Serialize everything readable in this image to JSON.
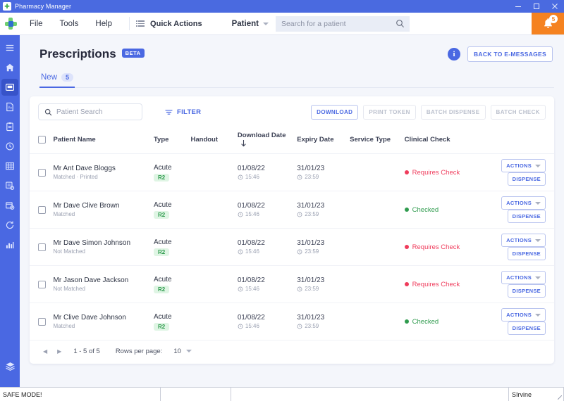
{
  "window": {
    "title": "Pharmacy Manager",
    "app_icon": "pharmacy-cross-icon",
    "minimize": "—",
    "maximize": "□",
    "close": "✕"
  },
  "menubar": {
    "items": [
      "File",
      "Tools",
      "Help"
    ],
    "quick_actions_label": "Quick Actions",
    "patient_dropdown_label": "Patient",
    "patient_search_placeholder": "Search for a patient",
    "notification_count": "5"
  },
  "sidebar": {
    "items": [
      {
        "icon": "hamburger-menu-icon",
        "active": false
      },
      {
        "icon": "home-icon",
        "active": false
      },
      {
        "icon": "messages-icon",
        "active": true
      },
      {
        "icon": "prescription-document-icon",
        "active": false
      },
      {
        "icon": "clipboard-icon",
        "active": false
      },
      {
        "icon": "clock-icon",
        "active": false
      },
      {
        "icon": "grid-icon",
        "active": false
      },
      {
        "icon": "report-icon",
        "active": false
      },
      {
        "icon": "calendar-clock-icon",
        "active": false
      },
      {
        "icon": "refresh-circle-icon",
        "active": false
      },
      {
        "icon": "bar-chart-icon",
        "active": false
      }
    ],
    "bottom_icon": "layers-icon"
  },
  "header": {
    "title": "Prescriptions",
    "badge": "BETA",
    "info_icon": "i",
    "back_button": "BACK TO E-MESSAGES"
  },
  "tabs": [
    {
      "label": "New",
      "count": "5",
      "active": true
    }
  ],
  "toolbar": {
    "search_placeholder": "Patient Search",
    "search_value": "",
    "filter_label": "FILTER",
    "buttons": [
      {
        "label": "DOWNLOAD",
        "disabled": false
      },
      {
        "label": "PRINT TOKEN",
        "disabled": true
      },
      {
        "label": "BATCH DISPENSE",
        "disabled": true
      },
      {
        "label": "BATCH CHECK",
        "disabled": true
      }
    ]
  },
  "table": {
    "columns": [
      "Patient Name",
      "Type",
      "Handout",
      "Download Date",
      "Expiry Date",
      "Service Type",
      "Clinical Check"
    ],
    "sorted_column": "Download Date",
    "sort_direction": "desc",
    "row_actions": {
      "actions": "ACTIONS",
      "dispense": "DISPENSE"
    },
    "rows": [
      {
        "name": "Mr Ant Dave Bloggs",
        "status": "Matched · Printed",
        "type": "Acute",
        "rx_badge": "R2",
        "handout": "",
        "download_date": "01/08/22",
        "download_time": "15:46",
        "expiry_date": "31/01/23",
        "expiry_time": "23:59",
        "service_type": "",
        "clinical_check": "Requires Check",
        "clinical_state": "requires"
      },
      {
        "name": "Mr Dave Clive Brown",
        "status": "Matched",
        "type": "Acute",
        "rx_badge": "R2",
        "handout": "",
        "download_date": "01/08/22",
        "download_time": "15:46",
        "expiry_date": "31/01/23",
        "expiry_time": "23:59",
        "service_type": "",
        "clinical_check": "Checked",
        "clinical_state": "checked"
      },
      {
        "name": "Mr Dave Simon Johnson",
        "status": "Not Matched",
        "type": "Acute",
        "rx_badge": "R2",
        "handout": "",
        "download_date": "01/08/22",
        "download_time": "15:46",
        "expiry_date": "31/01/23",
        "expiry_time": "23:59",
        "service_type": "",
        "clinical_check": "Requires Check",
        "clinical_state": "requires"
      },
      {
        "name": "Mr Jason Dave Jackson",
        "status": "Not Matched",
        "type": "Acute",
        "rx_badge": "R2",
        "handout": "",
        "download_date": "01/08/22",
        "download_time": "15:46",
        "expiry_date": "31/01/23",
        "expiry_time": "23:59",
        "service_type": "",
        "clinical_check": "Requires Check",
        "clinical_state": "requires"
      },
      {
        "name": "Mr Clive Dave Johnson",
        "status": "Matched",
        "type": "Acute",
        "rx_badge": "R2",
        "handout": "",
        "download_date": "01/08/22",
        "download_time": "15:46",
        "expiry_date": "31/01/23",
        "expiry_time": "23:59",
        "service_type": "",
        "clinical_check": "Checked",
        "clinical_state": "checked"
      }
    ]
  },
  "pagination": {
    "prev": "◀",
    "next": "▶",
    "range": "1 - 5 of 5",
    "rows_per_page_label": "Rows per page:",
    "rows_per_page_value": "10"
  },
  "statusbar": {
    "left": "SAFE MODE!",
    "cell2": "",
    "cell3": "",
    "right": "SIrvine"
  },
  "colors": {
    "titlebar_blue": "#4a6ae0",
    "sidebar_blue": "#4a68e2",
    "accent": "#4a68e2",
    "notification_orange": "#f58220",
    "requires_check_red": "#ef3b5b",
    "checked_green": "#2f9b4e",
    "rx_badge_green": "#2f9b4e",
    "page_background": "#f4f6fb"
  }
}
